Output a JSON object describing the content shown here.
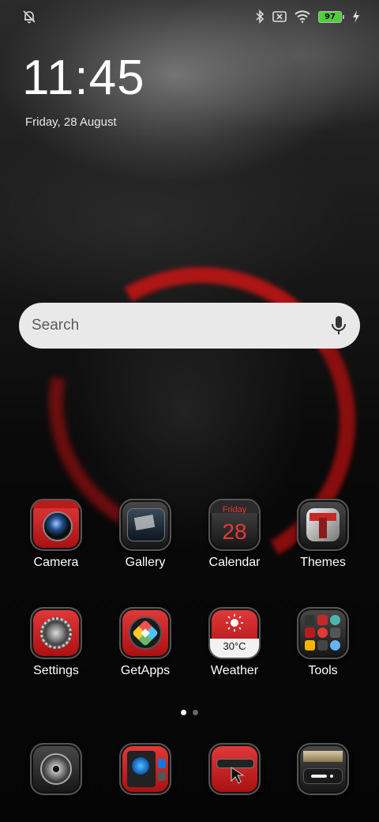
{
  "status_bar": {
    "battery_level": "97",
    "icons": [
      "alarm-off-icon",
      "bluetooth-icon",
      "sim-x-icon",
      "wifi-icon",
      "battery-icon",
      "charging-bolt-icon"
    ],
    "battery_color": "#4cd137"
  },
  "lock": {
    "time": "11:45",
    "date": "Friday, 28 August"
  },
  "search": {
    "placeholder": "Search",
    "icon": "microphone-icon"
  },
  "apps_row1": [
    {
      "label": "Camera",
      "icon": "camera-icon"
    },
    {
      "label": "Gallery",
      "icon": "gallery-icon"
    },
    {
      "label": "Calendar",
      "icon": "calendar-icon",
      "day_name": "Friday",
      "day_number": "28"
    },
    {
      "label": "Themes",
      "icon": "themes-icon"
    }
  ],
  "apps_row2": [
    {
      "label": "Settings",
      "icon": "gear-icon"
    },
    {
      "label": "GetApps",
      "icon": "getapps-icon"
    },
    {
      "label": "Weather",
      "icon": "sun-icon",
      "temperature": "30°C"
    },
    {
      "label": "Tools",
      "icon": "tools-folder-icon"
    }
  ],
  "dock": [
    {
      "icon": "phone-dial-icon"
    },
    {
      "icon": "contacts-icon"
    },
    {
      "icon": "browser-icon"
    },
    {
      "icon": "messages-icon"
    }
  ],
  "page_indicator": {
    "pages": 2,
    "current": 1
  },
  "colors": {
    "accent_red": "#d21f25",
    "search_bg": "#e9e9e9"
  }
}
